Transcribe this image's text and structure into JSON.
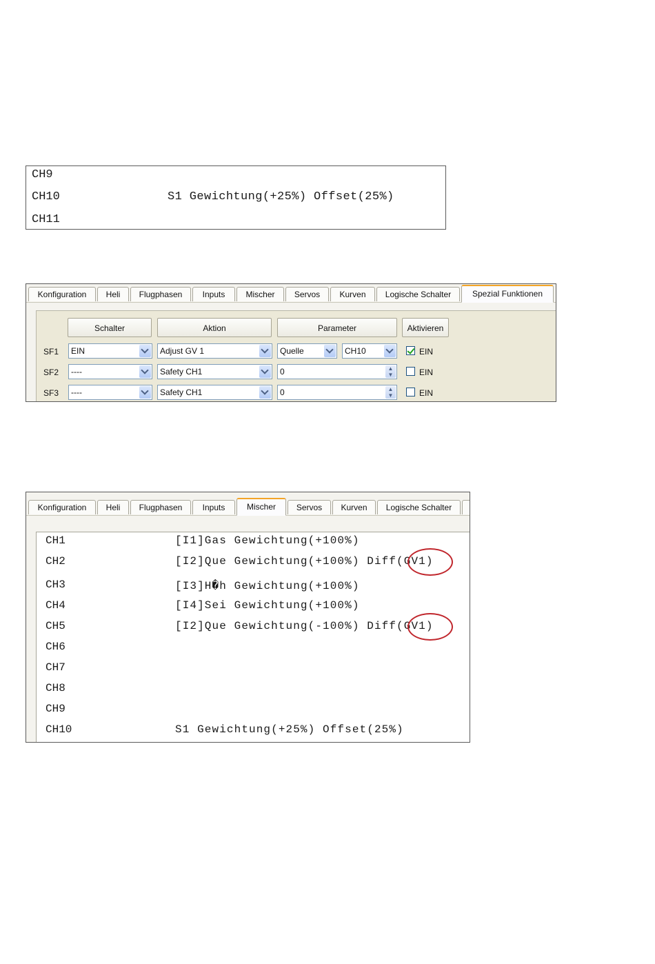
{
  "panel1": {
    "rows": [
      {
        "ch": "CH9",
        "text": ""
      },
      {
        "ch": "CH10",
        "text": "S1 Gewichtung(+25%) Offset(25%)"
      },
      {
        "ch": "CH11",
        "text": ""
      }
    ]
  },
  "tabs_a": [
    {
      "label": "Konfiguration"
    },
    {
      "label": "Heli"
    },
    {
      "label": "Flugphasen"
    },
    {
      "label": "Inputs"
    },
    {
      "label": "Mischer"
    },
    {
      "label": "Servos"
    },
    {
      "label": "Kurven"
    },
    {
      "label": "Logische Schalter"
    },
    {
      "label": "Spezial Funktionen"
    }
  ],
  "special_functions": {
    "headers": {
      "switch": "Schalter",
      "action": "Aktion",
      "parameter": "Parameter",
      "enable": "Aktivieren"
    },
    "rows": [
      {
        "id": "SF1",
        "switch": "EIN",
        "action": "Adjust GV 1",
        "param_mode": "Quelle",
        "param_value": "CH10",
        "enabled": true,
        "enable_label": "EIN"
      },
      {
        "id": "SF2",
        "switch": "----",
        "action": "Safety CH1",
        "param_value": "0",
        "enabled": false,
        "enable_label": "EIN"
      },
      {
        "id": "SF3",
        "switch": "----",
        "action": "Safety CH1",
        "param_value": "0",
        "enabled": false,
        "enable_label": "EIN"
      }
    ]
  },
  "tabs_b": [
    {
      "label": "Konfiguration"
    },
    {
      "label": "Heli"
    },
    {
      "label": "Flugphasen"
    },
    {
      "label": "Inputs"
    },
    {
      "label": "Mischer"
    },
    {
      "label": "Servos"
    },
    {
      "label": "Kurven"
    },
    {
      "label": "Logische Schalter"
    }
  ],
  "mixer": {
    "rows": [
      {
        "ch": "CH1",
        "text": "[I1]Gas Gewichtung(+100%)"
      },
      {
        "ch": "CH2",
        "text": "[I2]Que Gewichtung(+100%) Diff(GV1)"
      },
      {
        "ch": "CH3",
        "text": "[I3]H�h Gewichtung(+100%)"
      },
      {
        "ch": "CH4",
        "text": "[I4]Sei Gewichtung(+100%)"
      },
      {
        "ch": "CH5",
        "text": "[I2]Que Gewichtung(-100%) Diff(GV1)"
      },
      {
        "ch": "CH6",
        "text": ""
      },
      {
        "ch": "CH7",
        "text": ""
      },
      {
        "ch": "CH8",
        "text": ""
      },
      {
        "ch": "CH9",
        "text": ""
      },
      {
        "ch": "CH10",
        "text": "S1 Gewichtung(+25%) Offset(25%)"
      }
    ],
    "highlight_color": "#c0262c"
  }
}
